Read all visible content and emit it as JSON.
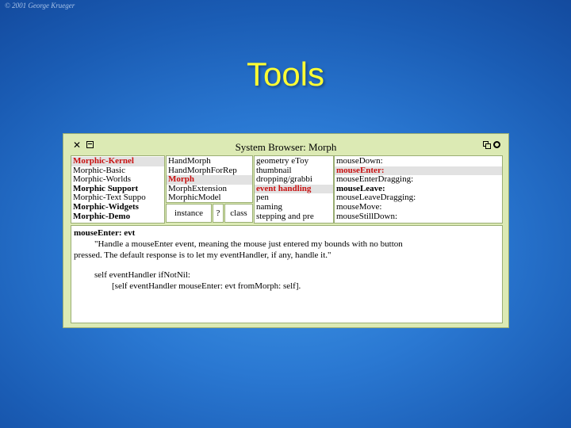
{
  "slide": {
    "copyright": "© 2001 George Krueger",
    "title": "Tools"
  },
  "browser": {
    "title": "System Browser: Morph",
    "categories": [
      {
        "label": "Morphic-Kernel",
        "state": "selected-red"
      },
      {
        "label": "Morphic-Basic",
        "state": "normal"
      },
      {
        "label": "Morphic-Worlds",
        "state": "normal"
      },
      {
        "label": "Morphic Support",
        "state": "bold"
      },
      {
        "label": "Morphic-Text Suppo",
        "state": "normal"
      },
      {
        "label": "Morphic-Widgets",
        "state": "bold"
      },
      {
        "label": "Morphic-Demo",
        "state": "bold"
      }
    ],
    "classes": [
      {
        "label": "HandMorph",
        "state": "normal"
      },
      {
        "label": "HandMorphForRep",
        "state": "normal"
      },
      {
        "label": "Morph",
        "state": "selected-red"
      },
      {
        "label": "MorphExtension",
        "state": "normal"
      },
      {
        "label": "MorphicModel",
        "state": "normal"
      }
    ],
    "class_buttons": {
      "instance": "instance",
      "help": "?",
      "class": "class"
    },
    "protocols": [
      {
        "label": "geometry eToy",
        "state": "normal"
      },
      {
        "label": "thumbnail",
        "state": "normal"
      },
      {
        "label": "dropping/grabbi",
        "state": "normal"
      },
      {
        "label": "event handling",
        "state": "selected-red"
      },
      {
        "label": "pen",
        "state": "normal"
      },
      {
        "label": "naming",
        "state": "normal"
      },
      {
        "label": "stepping and pre",
        "state": "normal"
      }
    ],
    "methods": [
      {
        "label": "mouseDown:",
        "state": "normal"
      },
      {
        "label": "mouseEnter:",
        "state": "selected-red"
      },
      {
        "label": "mouseEnterDragging:",
        "state": "normal"
      },
      {
        "label": "mouseLeave:",
        "state": "bold"
      },
      {
        "label": "mouseLeaveDragging:",
        "state": "normal"
      },
      {
        "label": "mouseMove:",
        "state": "normal"
      },
      {
        "label": "mouseStillDown:",
        "state": "normal"
      }
    ],
    "code": {
      "selector": "mouseEnter: evt",
      "comment_line1": "\"Handle a mouseEnter event, meaning the mouse just entered my bounds with no button",
      "comment_line2": "pressed. The default response is to let my eventHandler, if any, handle it.\"",
      "body_line1": "self eventHandler ifNotNil:",
      "body_line2": "[self eventHandler mouseEnter: evt fromMorph: self]."
    }
  },
  "colors": {
    "window_bg": "#dceab4",
    "selection_red": "#c81010",
    "title_yellow": "#ffff33"
  }
}
